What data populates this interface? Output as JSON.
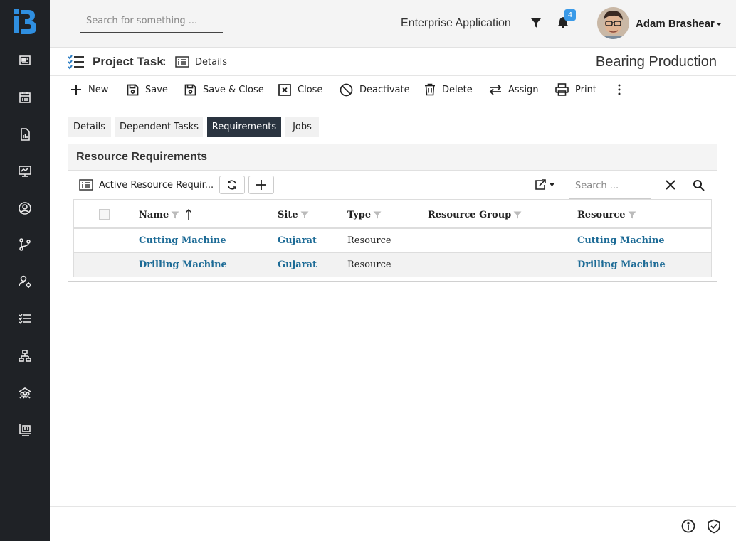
{
  "topbar": {
    "search_placeholder": "Search for something ...",
    "app_name": "Enterprise Application",
    "notification_count": "4",
    "user_name": "Adam Brashear"
  },
  "header": {
    "title": "Project Task",
    "colon": ":",
    "view_label": "Details",
    "record_title": "Bearing Production"
  },
  "toolbar": {
    "new": "New",
    "save": "Save",
    "save_close": "Save & Close",
    "close": "Close",
    "deactivate": "Deactivate",
    "delete": "Delete",
    "assign": "Assign",
    "print": "Print"
  },
  "tabs": [
    "Details",
    "Dependent Tasks",
    "Requirements",
    "Jobs"
  ],
  "panel": {
    "title": "Resource Requirements",
    "view_name": "Active Resource Requir...",
    "search_placeholder": "Search ..."
  },
  "grid": {
    "columns": [
      "Name",
      "Site",
      "Type",
      "Resource Group",
      "Resource"
    ],
    "rows": [
      {
        "name": "Cutting Machine",
        "site": "Gujarat",
        "type": "Resource",
        "group": "",
        "resource": "Cutting Machine"
      },
      {
        "name": "Drilling Machine",
        "site": "Gujarat",
        "type": "Resource",
        "group": "",
        "resource": "Drilling Machine"
      }
    ]
  },
  "colors": {
    "sidebar": "#1f2226",
    "brand": "#2f8fe0",
    "link": "#1d6b96",
    "active_tab": "#2a3440",
    "badge": "#3a9ae8"
  },
  "icons": {
    "sidebar": [
      "dashboard-icon",
      "calendar-icon",
      "report-icon",
      "monitor-settings-icon",
      "user-circle-icon",
      "branch-icon",
      "user-gear-icon",
      "checklist-icon",
      "hierarchy-icon",
      "team-icon",
      "board-icon"
    ]
  }
}
